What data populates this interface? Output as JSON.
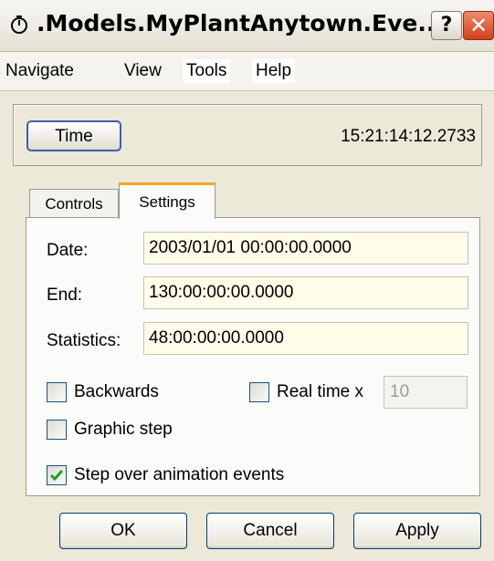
{
  "window": {
    "title": ".Models.MyPlantAnytown.Eve...",
    "help_label": "?",
    "close_label": "✕"
  },
  "menu": {
    "items": [
      "Navigate",
      "View",
      "Tools",
      "Help"
    ]
  },
  "time_panel": {
    "button_label": "Time",
    "readout": "15:21:14:12.2733"
  },
  "tabs": [
    {
      "label": "Controls",
      "active": false
    },
    {
      "label": "Settings",
      "active": true
    }
  ],
  "settings": {
    "date_label": "Date:",
    "date_value": "2003/01/01 00:00:00.0000",
    "end_label": "End:",
    "end_value": "130:00:00:00.0000",
    "statistics_label": "Statistics:",
    "statistics_value": "48:00:00:00.0000",
    "backwards_label": "Backwards",
    "backwards_checked": false,
    "realtime_label": "Real time x",
    "realtime_checked": false,
    "realtime_value": "10",
    "graphic_step_label": "Graphic step",
    "graphic_step_checked": false,
    "step_over_label": "Step over animation events",
    "step_over_checked": true
  },
  "buttons": {
    "ok": "OK",
    "cancel": "Cancel",
    "apply": "Apply"
  },
  "colors": {
    "dialog_bg": "#ece9d8",
    "active_tab_accent": "#f5a623",
    "check_mark": "#21a121",
    "close_button": "#d0401d"
  }
}
